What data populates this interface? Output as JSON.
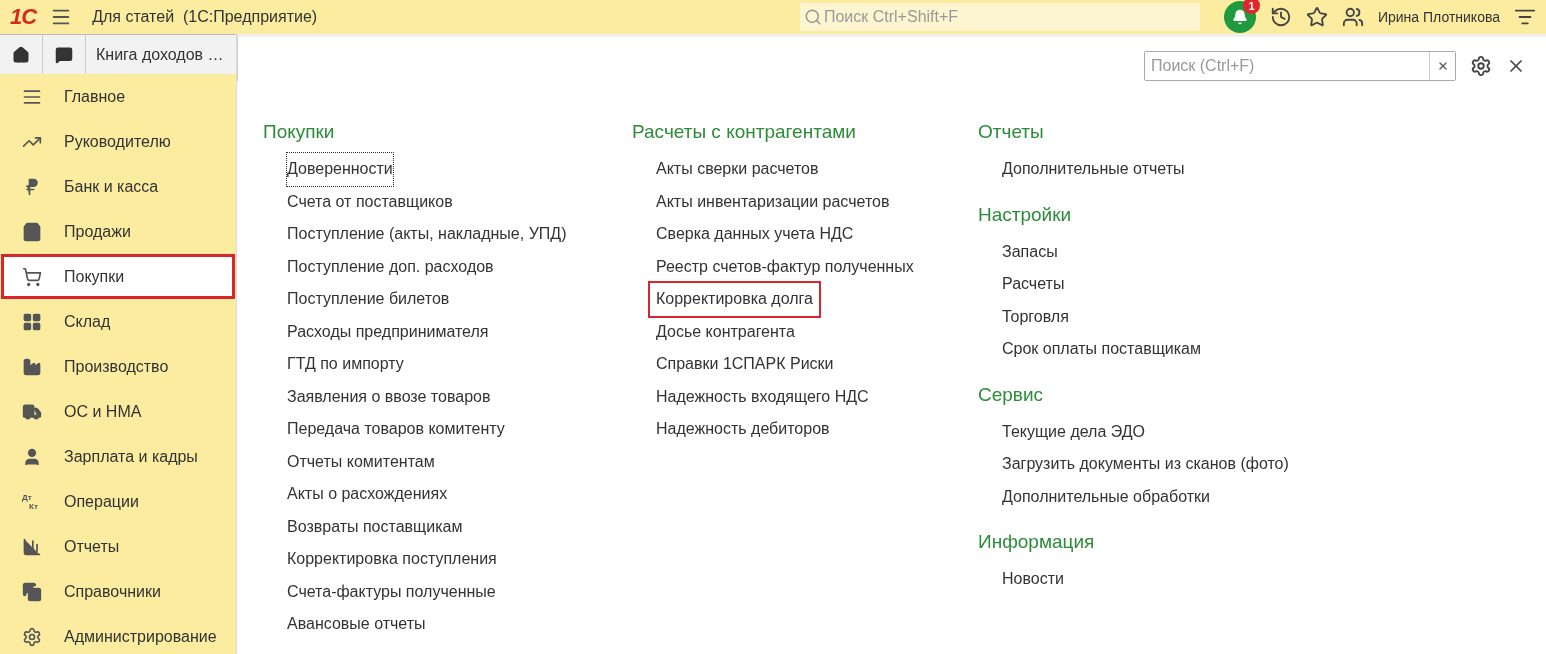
{
  "header": {
    "logo": "1С",
    "title": "Для статей  (1С:Предприятие)",
    "search_placeholder": "Поиск Ctrl+Shift+F",
    "notifications": "1",
    "user": "Ирина Плотникова"
  },
  "tabs": [
    {
      "label": "Книга доходов …",
      "selected": true
    }
  ],
  "sidebar": {
    "items": [
      {
        "label": "Главное",
        "selected": false
      },
      {
        "label": "Руководителю",
        "selected": false
      },
      {
        "label": "Банк и касса",
        "selected": false
      },
      {
        "label": "Продажи",
        "selected": false
      },
      {
        "label": "Покупки",
        "selected": true
      },
      {
        "label": "Склад",
        "selected": false
      },
      {
        "label": "Производство",
        "selected": false
      },
      {
        "label": "ОС и НМА",
        "selected": false
      },
      {
        "label": "Зарплата и кадры",
        "selected": false
      },
      {
        "label": "Операции",
        "selected": false,
        "icon_lines": [
          "Дт",
          "Кт"
        ]
      },
      {
        "label": "Отчеты",
        "selected": false
      },
      {
        "label": "Справочники",
        "selected": false
      },
      {
        "label": "Администрирование",
        "selected": false
      }
    ]
  },
  "panel": {
    "search_placeholder": "Поиск (Ctrl+F)",
    "columns": [
      [
        {
          "title": "Покупки",
          "items": [
            {
              "label": "Доверенности",
              "focused": true,
              "highlighted": false
            },
            {
              "label": "Счета от поставщиков",
              "focused": false,
              "highlighted": false
            },
            {
              "label": "Поступление (акты, накладные, УПД)",
              "focused": false,
              "highlighted": false
            },
            {
              "label": "Поступление доп. расходов",
              "focused": false,
              "highlighted": false
            },
            {
              "label": "Поступление билетов",
              "focused": false,
              "highlighted": false
            },
            {
              "label": "Расходы предпринимателя",
              "focused": false,
              "highlighted": false
            },
            {
              "label": "ГТД по импорту",
              "focused": false,
              "highlighted": false
            },
            {
              "label": "Заявления о ввозе товаров",
              "focused": false,
              "highlighted": false
            },
            {
              "label": "Передача товаров комитенту",
              "focused": false,
              "highlighted": false
            },
            {
              "label": "Отчеты комитентам",
              "focused": false,
              "highlighted": false
            },
            {
              "label": "Акты о расхождениях",
              "focused": false,
              "highlighted": false
            },
            {
              "label": "Возвраты поставщикам",
              "focused": false,
              "highlighted": false
            },
            {
              "label": "Корректировка поступления",
              "focused": false,
              "highlighted": false
            },
            {
              "label": "Счета-фактуры полученные",
              "focused": false,
              "highlighted": false
            },
            {
              "label": "Авансовые отчеты",
              "focused": false,
              "highlighted": false
            }
          ]
        }
      ],
      [
        {
          "title": "Расчеты с контрагентами",
          "items": [
            {
              "label": "Акты сверки расчетов",
              "focused": false,
              "highlighted": false
            },
            {
              "label": "Акты инвентаризации расчетов",
              "focused": false,
              "highlighted": false
            },
            {
              "label": "Сверка данных учета НДС",
              "focused": false,
              "highlighted": false
            },
            {
              "label": "Реестр счетов-фактур полученных",
              "focused": false,
              "highlighted": false
            },
            {
              "label": "Корректировка долга",
              "focused": false,
              "highlighted": true
            },
            {
              "label": "Досье контрагента",
              "focused": false,
              "highlighted": false
            },
            {
              "label": "Справки 1СПАРК Риски",
              "focused": false,
              "highlighted": false
            },
            {
              "label": "Надежность входящего НДС",
              "focused": false,
              "highlighted": false
            },
            {
              "label": "Надежность дебиторов",
              "focused": false,
              "highlighted": false
            }
          ]
        }
      ],
      [
        {
          "title": "Отчеты",
          "items": [
            {
              "label": "Дополнительные отчеты",
              "focused": false,
              "highlighted": false
            }
          ]
        },
        {
          "title": "Настройки",
          "items": [
            {
              "label": "Запасы",
              "focused": false,
              "highlighted": false
            },
            {
              "label": "Расчеты",
              "focused": false,
              "highlighted": false
            },
            {
              "label": "Торговля",
              "focused": false,
              "highlighted": false
            },
            {
              "label": "Срок оплаты поставщикам",
              "focused": false,
              "highlighted": false
            }
          ]
        },
        {
          "title": "Сервис",
          "items": [
            {
              "label": "Текущие дела ЭДО",
              "focused": false,
              "highlighted": false
            },
            {
              "label": "Загрузить документы из сканов (фото)",
              "focused": false,
              "highlighted": false
            },
            {
              "label": "Дополнительные обработки",
              "focused": false,
              "highlighted": false
            }
          ]
        },
        {
          "title": "Информация",
          "items": [
            {
              "label": "Новости",
              "focused": false,
              "highlighted": false
            }
          ]
        }
      ]
    ]
  }
}
